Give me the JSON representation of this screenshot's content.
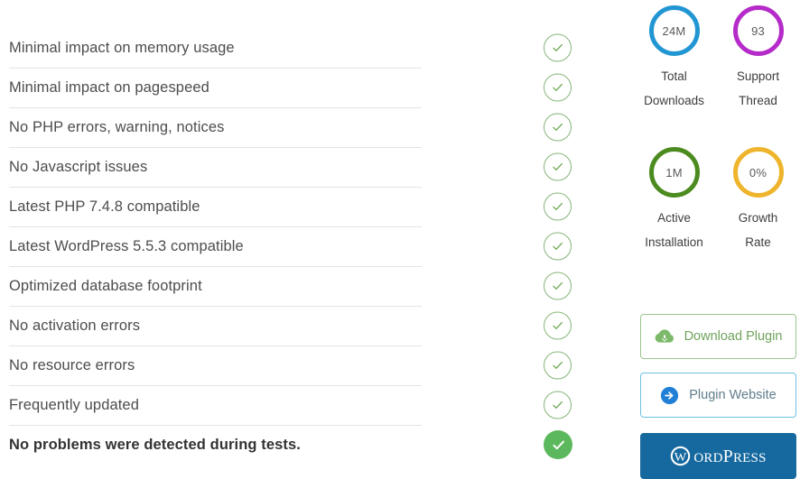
{
  "checklist": {
    "items": [
      {
        "label": "Minimal impact on memory usage",
        "status_icon": "check-circle-outline-icon",
        "summary": false
      },
      {
        "label": "Minimal impact on pagespeed",
        "status_icon": "check-circle-outline-icon",
        "summary": false
      },
      {
        "label": "No PHP errors, warning, notices",
        "status_icon": "check-circle-outline-icon",
        "summary": false
      },
      {
        "label": "No Javascript issues",
        "status_icon": "check-circle-outline-icon",
        "summary": false
      },
      {
        "label": "Latest PHP 7.4.8 compatible",
        "status_icon": "check-circle-outline-icon",
        "summary": false
      },
      {
        "label": "Latest WordPress 5.5.3 compatible",
        "status_icon": "check-circle-outline-icon",
        "summary": false
      },
      {
        "label": "Optimized database footprint",
        "status_icon": "check-circle-outline-icon",
        "summary": false
      },
      {
        "label": "No activation errors",
        "status_icon": "check-circle-outline-icon",
        "summary": false
      },
      {
        "label": "No resource errors",
        "status_icon": "check-circle-outline-icon",
        "summary": false
      },
      {
        "label": "Frequently updated",
        "status_icon": "check-circle-outline-icon",
        "summary": false
      },
      {
        "label": "No problems were detected during tests.",
        "status_icon": "check-circle-filled-icon",
        "summary": true
      }
    ]
  },
  "stats": {
    "items": [
      {
        "value": "24M",
        "label_line1": "Total",
        "label_line2": "Downloads",
        "ring_color": "#2196d3"
      },
      {
        "value": "93",
        "label_line1": "Support",
        "label_line2": "Thread",
        "ring_color": "#b52bc9"
      },
      {
        "value": "1M",
        "label_line1": "Active",
        "label_line2": "Installation",
        "ring_color": "#4b8b1f"
      },
      {
        "value": "0%",
        "label_line1": "Growth",
        "label_line2": "Rate",
        "ring_color": "#eeb42b"
      }
    ]
  },
  "actions": {
    "download": {
      "label": "Download Plugin",
      "icon": "cloud-download-icon",
      "border_color": "#9ec48f",
      "text_color": "#6fa35c"
    },
    "website": {
      "label": "Plugin Website",
      "icon": "arrow-right-circle-icon",
      "border_color": "#6ec1e4",
      "text_color": "#5f7d8c"
    },
    "wordpress": {
      "label_w": "W",
      "label_main": "ORD",
      "label_cap": "P",
      "label_rest": "RESS",
      "icon": "wordpress-logo-icon",
      "background_color": "#16699f"
    }
  },
  "colors": {
    "check_outline": "#86b579",
    "check_filled": "#5cb85c",
    "divider": "#e3e3e3",
    "text": "#4d4d4d"
  }
}
